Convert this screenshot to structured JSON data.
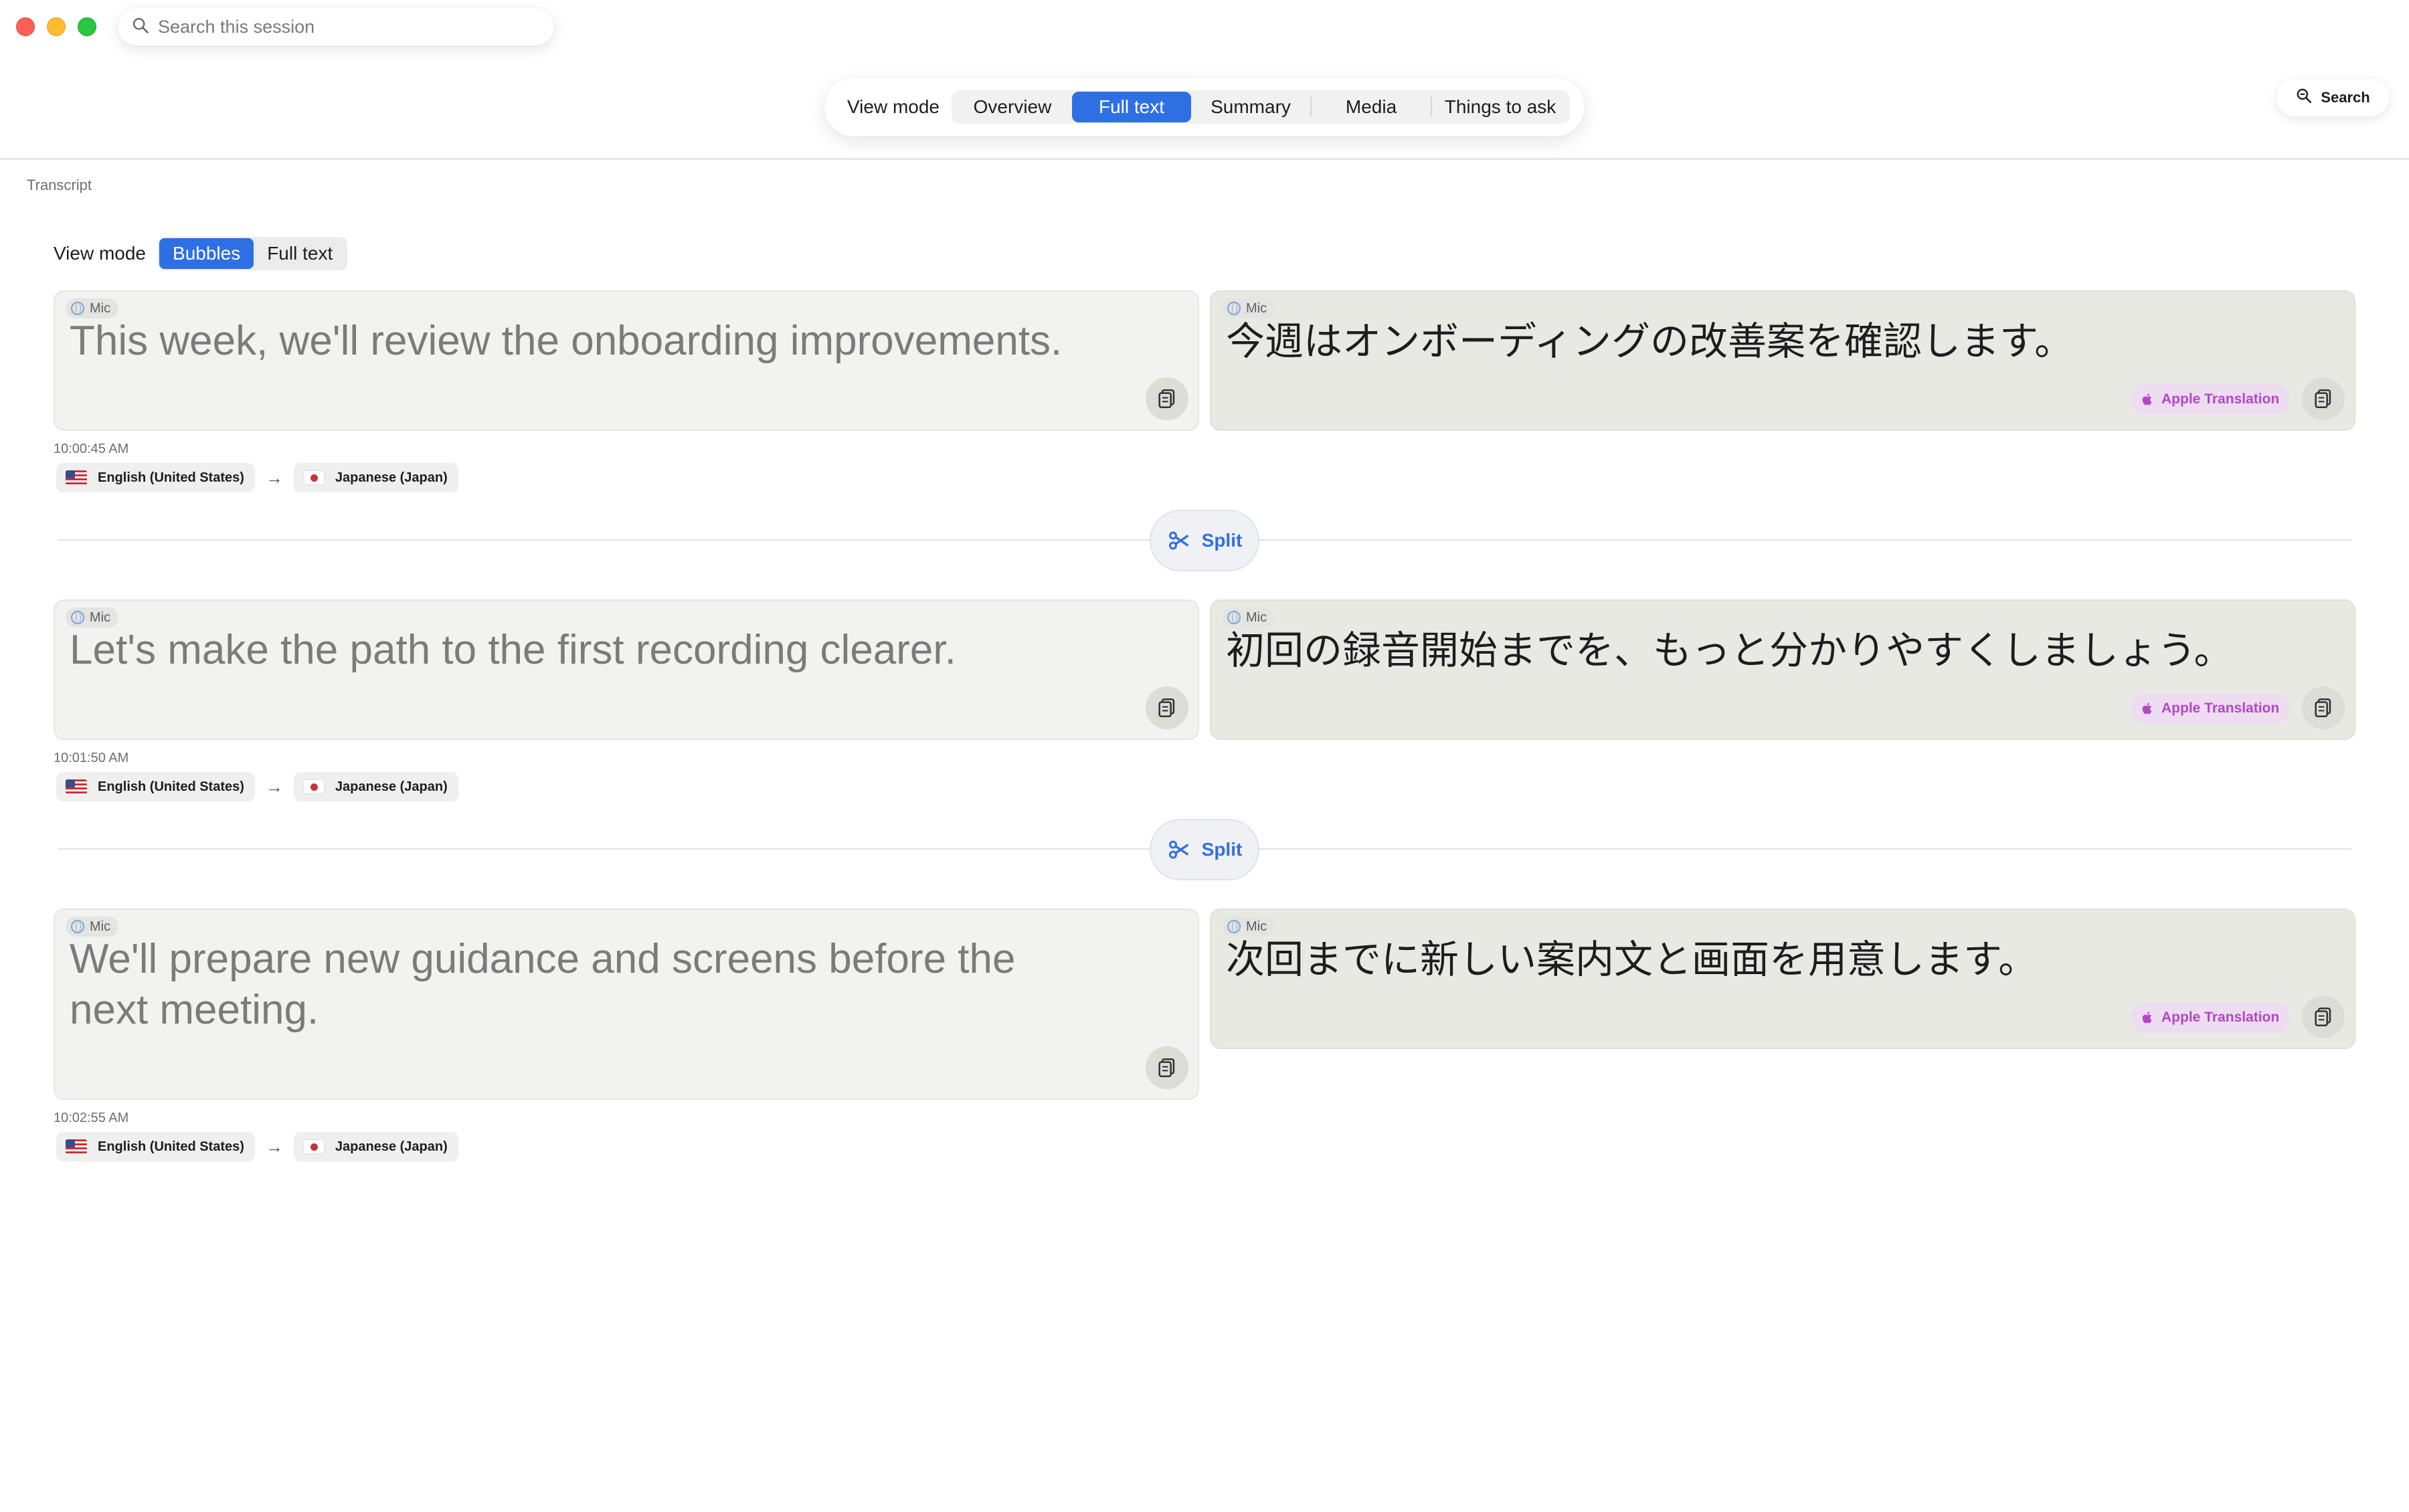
{
  "window": {
    "search_placeholder": "Search this session"
  },
  "top_bar": {
    "view_mode_label": "View mode",
    "tabs": [
      {
        "label": "Overview",
        "active": false
      },
      {
        "label": "Full text",
        "active": true
      },
      {
        "label": "Summary",
        "active": false
      },
      {
        "label": "Media",
        "active": false
      },
      {
        "label": "Things to ask",
        "active": false
      }
    ],
    "search_button": "Search"
  },
  "transcript": {
    "section_label": "Transcript",
    "view_mode_label": "View mode",
    "modes": [
      {
        "label": "Bubbles",
        "active": true
      },
      {
        "label": "Full text",
        "active": false
      }
    ],
    "split_label": "Split",
    "entries": [
      {
        "source_tag": "Mic",
        "source_text": "This week, we'll review the onboarding improvements.",
        "target_tag": "Mic",
        "target_text": "今週はオンボーディングの改善案を確認します。",
        "provider": "Apple Translation",
        "timestamp": "10:00:45 AM",
        "from_lang": "English (United States)",
        "to_lang": "Japanese (Japan)"
      },
      {
        "source_tag": "Mic",
        "source_text": "Let's make the path to the first recording clearer.",
        "target_tag": "Mic",
        "target_text": "初回の録音開始までを、もっと分かりやすくしましょう。",
        "provider": "Apple Translation",
        "timestamp": "10:01:50 AM",
        "from_lang": "English (United States)",
        "to_lang": "Japanese (Japan)"
      },
      {
        "source_tag": "Mic",
        "source_text_line1": "We'll prepare new guidance and screens before the",
        "source_text_line2": "next meeting.",
        "target_tag": "Mic",
        "target_text": "次回までに新しい案内文と画面を用意します。",
        "provider": "Apple Translation",
        "timestamp": "10:02:55 AM",
        "from_lang": "English (United States)",
        "to_lang": "Japanese (Japan)"
      }
    ]
  },
  "colors": {
    "accent": "#2f6fe4",
    "apple_translation": "#b247c6"
  }
}
